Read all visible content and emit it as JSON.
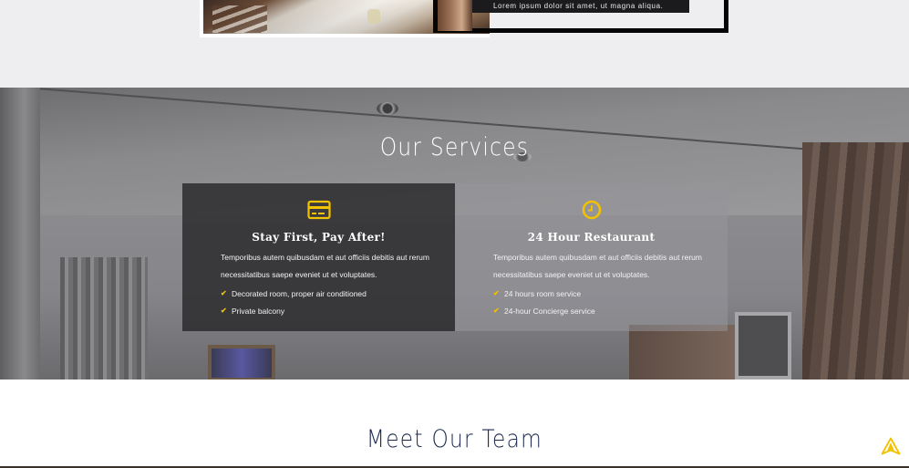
{
  "about": {
    "caption": "Lorem ipsum dolor sit amet, ut magna aliqua."
  },
  "services": {
    "title": "Our Services",
    "cards": [
      {
        "icon": "credit-card-icon",
        "title": "Stay First, Pay After!",
        "description": "Temporibus autem quibusdam et aut officiis debitis aut rerum necessitatibus saepe eveniet ut et voluptates.",
        "features": [
          "Decorated room, proper air conditioned",
          "Private balcony"
        ]
      },
      {
        "icon": "clock-icon",
        "title": "24 Hour Restaurant",
        "description": "Temporibus autem quibusdam et aut officiis debitis aut rerum necessitatibus saepe eveniet ut et voluptates.",
        "features": [
          "24 hours room service",
          "24-hour Concierge service"
        ]
      }
    ]
  },
  "team": {
    "title": "Meet Our Team"
  },
  "colors": {
    "accent": "#f2c200",
    "heading_dark": "#1c2a4e"
  },
  "back_to_top": {
    "icon": "navigation-arrow-icon"
  }
}
